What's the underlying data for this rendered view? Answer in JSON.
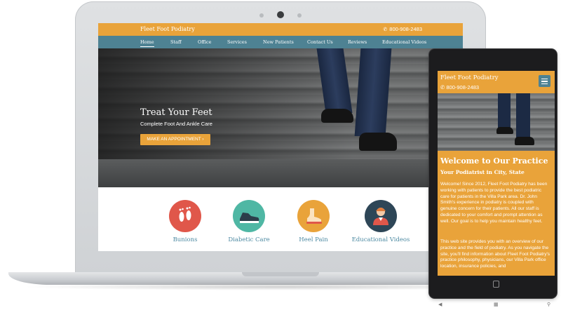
{
  "header": {
    "site_title": "Fleet Foot Podiatry",
    "phone": "800-908-2483"
  },
  "nav": {
    "items": [
      "Home",
      "Staff",
      "Office",
      "Services",
      "New Patients",
      "Contact Us",
      "Reviews",
      "Educational Videos"
    ],
    "active": "Home"
  },
  "hero": {
    "title": "Treat Your Feet",
    "subtitle": "Complete Foot And Ankle Care",
    "button_label": "MAKE AN APPOINTMENT ›"
  },
  "features": [
    {
      "label": "Bunions",
      "icon": "footprints-icon",
      "color": "#e0574a"
    },
    {
      "label": "Diabetic Care",
      "icon": "shoe-icon",
      "color": "#4fb7a4"
    },
    {
      "label": "Heel Pain",
      "icon": "foot-insole-icon",
      "color": "#e9a33a"
    },
    {
      "label": "Educational Videos",
      "icon": "person-icon",
      "color": "#2e4657"
    }
  ],
  "mobile": {
    "site_title": "Fleet Foot Podiatry",
    "phone": "800-908-2483",
    "welcome_heading": "Welcome to Our Practice",
    "subheading": "Your Podiatrist in City, State",
    "paragraph_1": "Welcome! Since 2012, Fleet Foot Podiatry has been working with patients to provide the best podiatric care for patients in the Villa Park area. Dr. John Smith's experience in podiatry is coupled with genuine concern for their patients. All our staff is dedicated to your comfort and prompt attention as well. Our goal is to help you maintain healthy feet.",
    "paragraph_2": "This web site provides you with an overview of our practice and the field of podiatry. As you navigate the site, you'll find information about Fleet Foot Podiatry's practice philosophy, physicians, our Villa Park office location, insurance policies, and"
  },
  "colors": {
    "brand_orange": "#e9a33a",
    "nav_teal": "#4e8293",
    "link_blue": "#4d8aa2"
  }
}
